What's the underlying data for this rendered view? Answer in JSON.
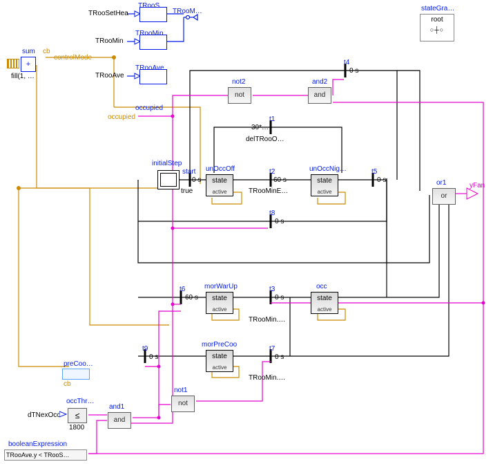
{
  "legend": {
    "stategraph_label": "stateGra…",
    "stategraph_root": "root",
    "stategraph_seq": "○┼○"
  },
  "top_inputs": {
    "TRooSetHea": "TRooSetHea",
    "TRooS": "TRooS…",
    "TRooM_out": "TRooM…",
    "TRooMin_in": "TRooMin",
    "TRooMin": "TRooMin",
    "TRooAve_in": "TRooAve",
    "TRooAve": "TRooAve"
  },
  "left": {
    "sum": "sum",
    "sum_sym": "+",
    "fill": "fill(1, …",
    "cb": "cb",
    "controlMode": "controlMode",
    "occupied_top": "occupied",
    "occupied_bot": "occupied",
    "preCoo": "preCoo…",
    "cb2": "cb",
    "occThr": "occThr…",
    "dTNexOcc": "dTNexOcc",
    "leq": "≤",
    "leq_val": "1800",
    "boolExpr": "booleanExpression",
    "boolExprBody": "TRooAve.y < TRooS…"
  },
  "logic": {
    "not2": "not2",
    "not2_txt": "not",
    "and2": "and2",
    "and2_txt": "and",
    "not1": "not1",
    "not1_txt": "not",
    "and1": "and1",
    "and1_txt": "and",
    "or1": "or1",
    "or1_txt": "or"
  },
  "out": {
    "yFan": "yFan"
  },
  "steps": {
    "initialStep": "initialStep",
    "start": "start",
    "true": "true",
    "zero_s": "0 s",
    "sixty_s": "60 s",
    "state": "state",
    "active": "active"
  },
  "blocks": {
    "unOccOff": "unOccOff",
    "unOccNig": "unOccNig…",
    "morWarUp": "morWarUp",
    "morPreCoo": "morPreCoo",
    "occ": "occ"
  },
  "transitions": {
    "t1": "t1",
    "t2": "t2",
    "t3": "t3",
    "t4": "t4",
    "t5": "t5",
    "t6": "t6",
    "t7": "t7",
    "t8": "t8",
    "t9": "t9",
    "t1_note": "30*…",
    "delTRooOnOff": "delTRooO…",
    "TRooMinE": "TRooMinE…",
    "TRooMin3": "TRooMin.…",
    "TRooMin7": "TRooMin.…"
  }
}
